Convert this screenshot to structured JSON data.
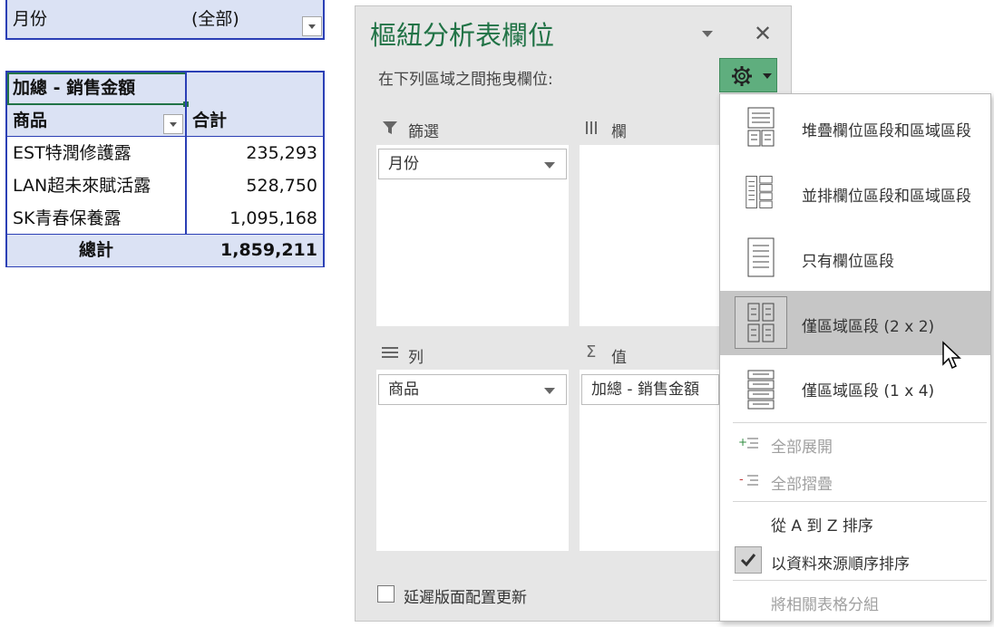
{
  "pivot": {
    "filter_label": "月份",
    "filter_value": "(全部)",
    "values_header": "加總 - 銷售金額",
    "row_header": "商品",
    "col_header": "合計",
    "rows": [
      {
        "label": "EST特潤修護露",
        "value": "235,293"
      },
      {
        "label": "LAN超未來賦活露",
        "value": "528,750"
      },
      {
        "label": "SK青春保養露",
        "value": "1,095,168"
      }
    ],
    "total_label": "總計",
    "total_value": "1,859,211"
  },
  "pane": {
    "title": "樞紐分析表欄位",
    "drag_hint": "在下列區域之間拖曳欄位:",
    "zones": {
      "filters": {
        "title": "篩選",
        "field": "月份"
      },
      "columns": {
        "title": "欄"
      },
      "rows": {
        "title": "列",
        "field": "商品"
      },
      "values": {
        "title": "值",
        "field": "加總 - 銷售金額"
      }
    },
    "defer_label": "延遲版面配置更新",
    "colors": {
      "accent": "#217346",
      "gear_bg": "#5fae7e",
      "selection": "#c6c6c6"
    }
  },
  "menu": {
    "layouts": [
      {
        "label": "堆疊欄位區段和區域區段",
        "icon": "stacked-layout-icon"
      },
      {
        "label": "並排欄位區段和區域區段",
        "icon": "side-by-side-layout-icon"
      },
      {
        "label": "只有欄位區段",
        "icon": "fields-only-layout-icon"
      },
      {
        "label": "僅區域區段 (2 x 2)",
        "icon": "areas-2x2-layout-icon"
      },
      {
        "label": "僅區域區段 (1 x 4)",
        "icon": "areas-1x4-layout-icon"
      }
    ],
    "expand_all": "全部展開",
    "collapse_all": "全部摺疊",
    "sort_az": "從 A 到 Z 排序",
    "sort_source": "以資料來源順序排序",
    "group_tables": "將相關表格分組"
  }
}
